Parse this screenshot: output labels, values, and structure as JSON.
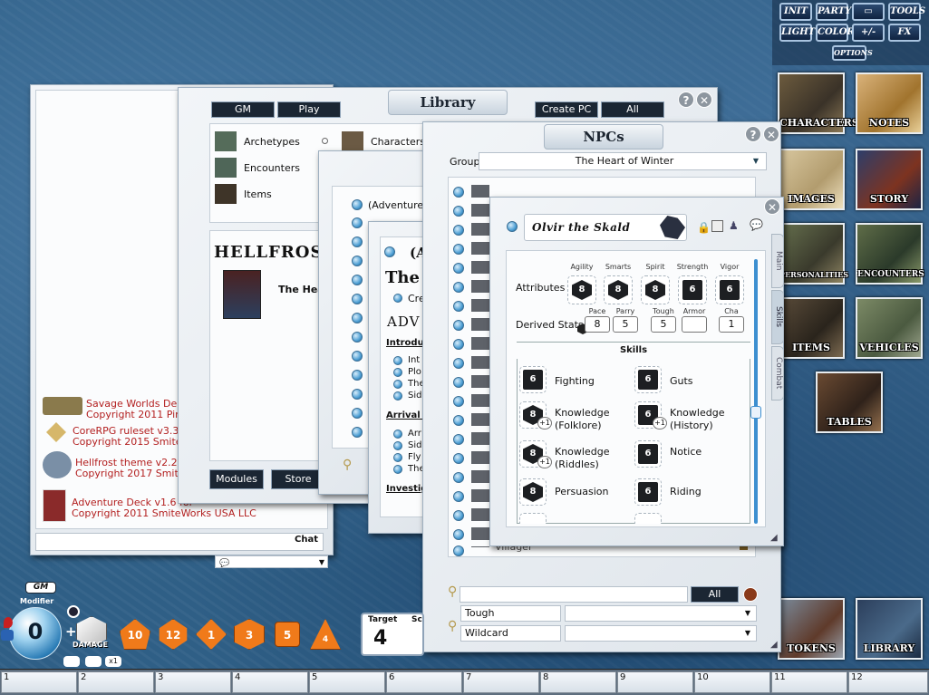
{
  "toolbar": {
    "init": "INIT",
    "party": "PARTY",
    "tools": "TOOLS",
    "light": "LIGHT",
    "color": "COLOR",
    "plusminus": "+/-",
    "fx": "FX",
    "options": "OPTIONS"
  },
  "sidebar": {
    "tiles": [
      "CHARACTERS",
      "NOTES",
      "IMAGES",
      "STORY",
      "PERSONALITIES",
      "ENCOUNTERS",
      "ITEMS",
      "VEHICLES",
      "TABLES",
      "TOKENS",
      "LIBRARY"
    ]
  },
  "chat": {
    "modules": [
      {
        "title": "Savage Worlds Delux",
        "copyright": "Copyright 2011 Pinna"
      },
      {
        "title": "CoreRPG ruleset v3.3.5",
        "copyright": "Copyright 2015 Smitewo"
      },
      {
        "title": "Hellfrost theme v2.2 fo",
        "copyright": "Copyright 2017 SmiteW"
      },
      {
        "title": "Adventure Deck v1.6 for",
        "copyright": "Copyright 2011 SmiteWorks USA LLC"
      }
    ],
    "chat_label": "Chat"
  },
  "library": {
    "title": "Library",
    "tabs": [
      "GM",
      "Play",
      "Create PC",
      "All"
    ],
    "categories": [
      "Archetypes",
      "Characters",
      "Encounters",
      "Items"
    ],
    "book_title": "HELLFROST",
    "book_entry": "The Heart",
    "footer": [
      "Modules",
      "Store"
    ]
  },
  "story": {
    "entry": "(Adventure I",
    "heading_partial": "(A",
    "the_partial": "The",
    "cre_partial": "Cre",
    "adv_partial": "ADV",
    "introduc": "Introduc",
    "intro_items": [
      "Int",
      "Plo",
      "The",
      "Sid"
    ],
    "arrival": "Arrival in",
    "arrival_items": [
      "Arr",
      "Sid",
      "Fly",
      "The"
    ],
    "investig": "Investig"
  },
  "npcs": {
    "title": "NPCs",
    "group_label": "Group",
    "group_value": "The Heart of Winter",
    "last_entry": "Villager",
    "filter_all": "All",
    "filters": [
      "Tough",
      "Wildcard"
    ]
  },
  "npc_sheet": {
    "name": "Olvir the Skald",
    "attributes_label": "Attributes",
    "attributes": [
      {
        "name": "Agility",
        "die": "8"
      },
      {
        "name": "Smarts",
        "die": "8"
      },
      {
        "name": "Spirit",
        "die": "8"
      },
      {
        "name": "Strength",
        "die": "6"
      },
      {
        "name": "Vigor",
        "die": "6"
      }
    ],
    "derived_label": "Derived Stats",
    "derived": [
      {
        "name": "Pace",
        "value": "8"
      },
      {
        "name": "Parry",
        "value": "5"
      },
      {
        "name": "Tough",
        "value": "5"
      },
      {
        "name": "Armor",
        "value": ""
      },
      {
        "name": "Cha",
        "value": "1"
      }
    ],
    "skills_label": "Skills",
    "skills": [
      {
        "name": "Fighting",
        "die": "6",
        "mod": ""
      },
      {
        "name": "Guts",
        "die": "6",
        "mod": ""
      },
      {
        "name": "Knowledge (Folklore)",
        "die": "8",
        "mod": "+1"
      },
      {
        "name": "Knowledge (History)",
        "die": "6",
        "mod": "+1"
      },
      {
        "name": "Knowledge (Riddles)",
        "die": "8",
        "mod": "+1"
      },
      {
        "name": "Notice",
        "die": "6",
        "mod": ""
      },
      {
        "name": "Persuasion",
        "die": "8",
        "mod": ""
      },
      {
        "name": "Riding",
        "die": "6",
        "mod": ""
      }
    ],
    "tabs": [
      "Main",
      "Skills",
      "Combat"
    ]
  },
  "dice": {
    "gm_label": "GM",
    "modifier_label": "Modifier",
    "modifier_value": "0",
    "damage_label": "DAMAGE",
    "x1": "x1",
    "orange": [
      "10",
      "12",
      "1",
      "3",
      "5",
      "4"
    ],
    "target_label": "Target",
    "target_value": "4",
    "score_partial": "Sc"
  },
  "hotkeys": [
    "1",
    "2",
    "3",
    "4",
    "5",
    "6",
    "7",
    "8",
    "9",
    "10",
    "11",
    "12"
  ],
  "colors": {
    "accent": "#1b2633",
    "background": "#2f5f86",
    "panel": "#e9edf1"
  }
}
